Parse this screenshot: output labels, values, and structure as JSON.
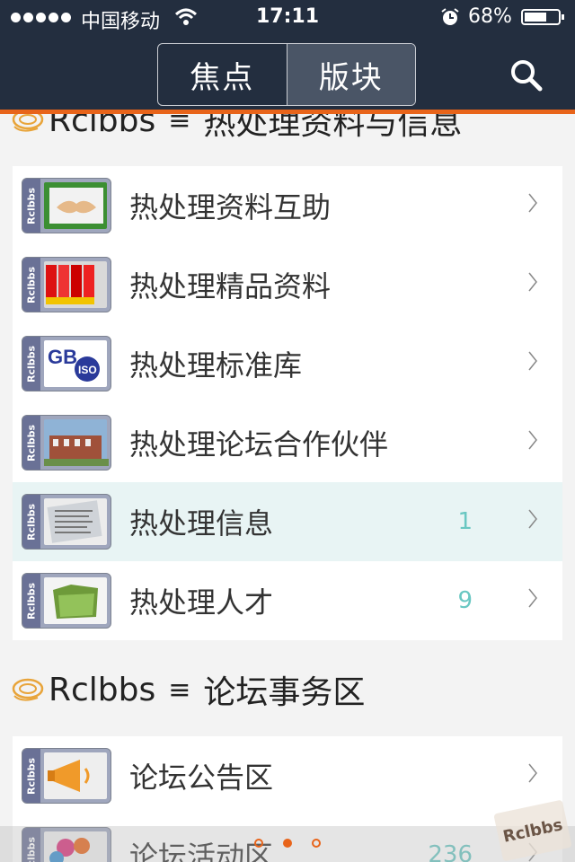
{
  "status_bar": {
    "carrier": "中国移动",
    "time": "17:11",
    "battery_percent": "68%",
    "battery_level": 0.68
  },
  "nav": {
    "tabs": [
      {
        "label": "焦点",
        "active": false
      },
      {
        "label": "版块",
        "active": true
      }
    ],
    "search_icon": "search-icon"
  },
  "sections": [
    {
      "prefix": "Rclbbs",
      "title": "热处理资料与信息",
      "items": [
        {
          "label": "热处理资料互助",
          "count": "",
          "icon": "handshake-thumb"
        },
        {
          "label": "热处理精品资料",
          "count": "",
          "icon": "binders-thumb"
        },
        {
          "label": "热处理标准库",
          "count": "",
          "icon": "gb-iso-thumb"
        },
        {
          "label": "热处理论坛合作伙伴",
          "count": "",
          "icon": "building-thumb"
        },
        {
          "label": "热处理信息",
          "count": "1",
          "icon": "newspaper-thumb"
        },
        {
          "label": "热处理人才",
          "count": "9",
          "icon": "folder-thumb"
        }
      ]
    },
    {
      "prefix": "Rclbbs",
      "title": "论坛事务区",
      "items": [
        {
          "label": "论坛公告区",
          "count": "",
          "icon": "megaphone-thumb"
        },
        {
          "label": "论坛活动区",
          "count": "236",
          "icon": "balloons-thumb"
        }
      ]
    }
  ],
  "thumb_tag": "Rclbbs",
  "watermark": "Rclbbs",
  "colors": {
    "nav_bg": "#232e3f",
    "accent": "#e8641a",
    "count": "#69c7c2",
    "highlight_row": "#e8f4f4"
  }
}
